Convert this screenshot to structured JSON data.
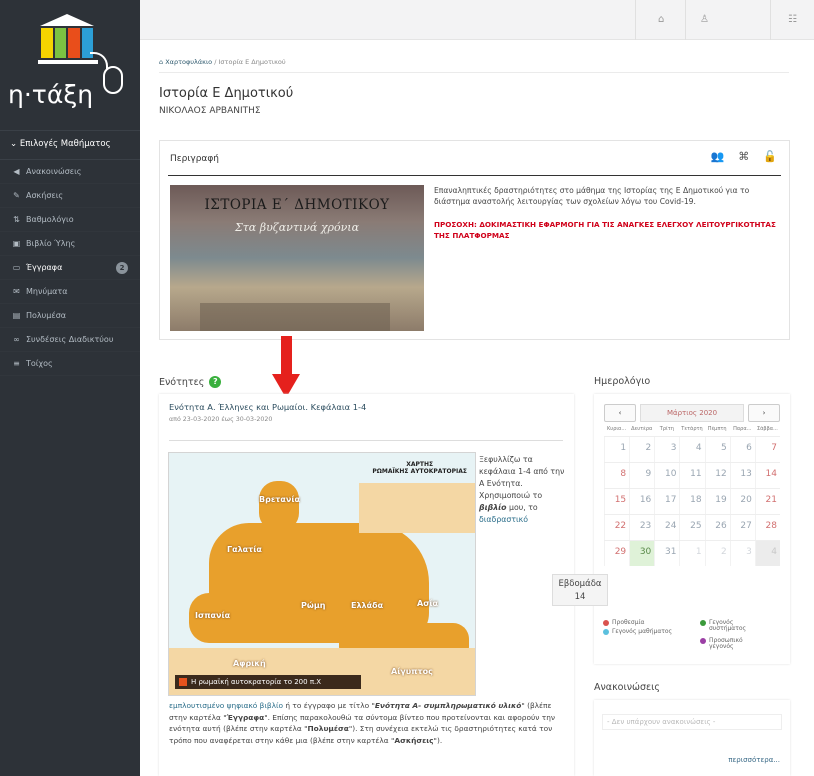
{
  "app": {
    "brand": "η·τάξη"
  },
  "colors": {
    "sidebar": "#2d3238",
    "accent_red": "#e5211d",
    "warning": "#d0021b",
    "link": "#2b4c5e",
    "help_green": "#3ab03e"
  },
  "sidebar": {
    "header": "Επιλογές Μαθήματος",
    "items": [
      {
        "label": "Ανακοινώσεις",
        "icon": "megaphone-icon"
      },
      {
        "label": "Ασκήσεις",
        "icon": "edit-icon"
      },
      {
        "label": "Βαθμολόγιο",
        "icon": "sort-icon"
      },
      {
        "label": "Βιβλίο Ύλης",
        "icon": "calendar-icon"
      },
      {
        "label": "Έγγραφα",
        "icon": "folder-icon",
        "badge": "2"
      },
      {
        "label": "Μηνύματα",
        "icon": "envelope-icon"
      },
      {
        "label": "Πολυμέσα",
        "icon": "film-icon"
      },
      {
        "label": "Συνδέσεις Διαδικτύου",
        "icon": "link-icon"
      },
      {
        "label": "Τοίχος",
        "icon": "list-icon"
      }
    ]
  },
  "topbar": {
    "icons": [
      "home-icon",
      "user-icon",
      "settings-icon"
    ]
  },
  "breadcrumb": {
    "home": "Χαρτοφυλάκιο",
    "separator": "/",
    "current": "Ιστορία Ε Δημοτικού"
  },
  "page": {
    "title": "Ιστορία Ε Δημοτικού",
    "subtitle": "ΝΙΚΟΛΑΟΣ ΑΡΒΑΝΙΤΗΣ"
  },
  "description": {
    "title": "Περιγραφή",
    "cover_line1": "ΙΣΤΟΡΙΑ Ε΄ ΔΗΜΟΤΙΚΟΥ",
    "cover_line2": "Στα βυζαντινά χρόνια",
    "text": "Επαναληπτικές δραστηριότητες στο μάθημα της Ιστορίας της Ε Δημοτικού για το διάστημα αναστολής λειτουργίας των σχολείων λόγω του Covid-19.",
    "warning": "ΠΡΟΣΟΧΗ: ΔΟΚΙΜΑΣΤΙΚΗ ΕΦΑΡΜΟΓΗ ΓΙΑ ΤΙΣ ΑΝΑΓΚΕΣ ΕΛΕΓΧΟΥ ΛΕΙΤΟΥΡΓΙΚΟΤΗΤΑΣ ΤΗΣ ΠΛΑΤΦΟΡΜΑΣ"
  },
  "units": {
    "title": "Ενότητες",
    "unit": {
      "title": "Ενότητα Α. Έλληνες και Ρωμαίοι. Κεφάλαια 1-4",
      "dates": "από 23-03-2020 έως 30-03-2020",
      "map_title_1": "ΧΑΡΤΗΣ",
      "map_title_2": "ΡΩΜΑΪΚΗΣ ΑΥΤΟΚΡΑΤΟΡΙΑΣ",
      "map_caption": "Η ρωμαϊκή αυτοκρατορία το 200 π.Χ",
      "map_labels": [
        "Βρετανία",
        "Γαλατία",
        "Ισπανία",
        "Ρώμη",
        "Ελλάδα",
        "Ασία",
        "Αφρική",
        "Αίγυπτος"
      ],
      "side_text_1": "Ξεφυλλίζω τα κεφάλαια 1-4 από την Α Ενότητα. Χρησιμοποιώ το",
      "side_text_bold": "βιβλίο",
      "side_text_2": "μου, το",
      "side_link": "διαδραστικό",
      "body_link": "εμπλουτισμένο ψηφιακό βιβλίο",
      "body_1": " ή το έγγραφο με τίτλο \"",
      "body_bold_1": "Ενότητα Α- συμπληρωματικό υλικό",
      "body_2": "\" (βλέπε στην καρτέλα \"",
      "body_bold_2": "Έγγραφα",
      "body_3": "\". Επίσης παρακολουθώ τα σύντομα βίντεο που προτείνονται και αφορούν την ενότητα αυτή (βλέπε στην καρτέλα \"",
      "body_bold_3": "Πολυμέσα",
      "body_4": "\"). Στη συνέχεια εκτελώ τις δραστηριότητες κατά τον τρόπο που αναφέρεται στην κάθε μια (βλέπε στην καρτέλα \"",
      "body_bold_4": "Ασκήσεις",
      "body_5": "\")."
    }
  },
  "calendar": {
    "title": "Ημερολόγιο",
    "prev": "‹",
    "next": "›",
    "month": "Μάρτιος 2020",
    "weekdays": [
      "Κυρια...",
      "Δευτέρα",
      "Τρίτη",
      "Τετάρτη",
      "Πέμπτη",
      "Παρα...",
      "Σάββα..."
    ],
    "weeks": [
      [
        "1",
        "2",
        "3",
        "4",
        "5",
        "6",
        "7"
      ],
      [
        "8",
        "9",
        "10",
        "11",
        "12",
        "13",
        "14"
      ],
      [
        "15",
        "16",
        "17",
        "18",
        "19",
        "20",
        "21"
      ],
      [
        "22",
        "23",
        "24",
        "25",
        "26",
        "27",
        "28"
      ],
      [
        "29",
        "30",
        "31",
        "1",
        "2",
        "3",
        "4"
      ]
    ],
    "week_tooltip_label": "Εβδομάδα",
    "week_tooltip_value": "14",
    "legend": [
      {
        "label": "Προθεσμία",
        "color": "#d9534f"
      },
      {
        "label": "Γεγονός μαθήματος",
        "color": "#5bc0de"
      },
      {
        "label": "Γεγονός συστήματος",
        "color": "#3a9a3a"
      },
      {
        "label": "Προσωπικό γεγονός",
        "color": "#9b3fa5"
      }
    ]
  },
  "announcements": {
    "title": "Ανακοινώσεις",
    "empty": "- Δεν υπάρχουν ανακοινώσεις -",
    "more": "περισσότερα..."
  }
}
